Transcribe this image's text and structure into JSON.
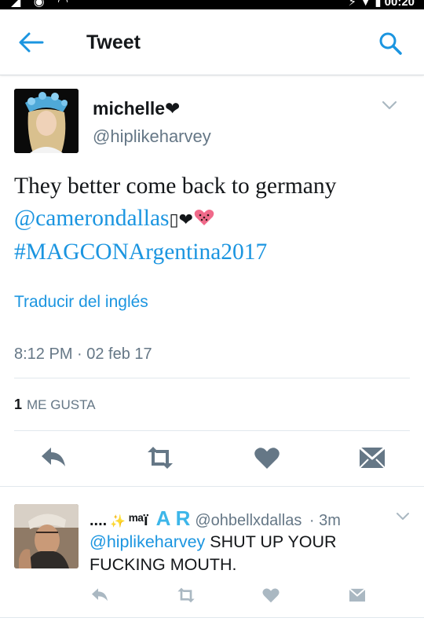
{
  "status_bar": {
    "left_icons": [
      "signal-icon",
      "wifi-icon"
    ],
    "right_text": "⚡ ▼ ▮ 00:20"
  },
  "app_bar": {
    "title": "Tweet",
    "back_icon": "back-arrow-icon",
    "search_icon": "search-icon"
  },
  "tweet": {
    "display_name": "michelle❤",
    "handle": "@hiplikeharvey",
    "text_plain": "They better come back to germany",
    "mention": "@camerondallas",
    "emoji_tail": "▯❤",
    "hashtag": "#MAGCONArgentina2017",
    "translate_label": "Traducir del inglés",
    "timestamp": "8:12 PM · 02 feb 17",
    "likes_count": "1",
    "likes_label": "ME GUSTA",
    "actions": [
      "reply-icon",
      "retweet-icon",
      "like-icon",
      "direct-message-icon"
    ]
  },
  "reply": {
    "name_prefix": "....",
    "name_mid": "ᵐᵃï",
    "name_blue": "A R",
    "handle": "@ohbellxdallas",
    "time": "· 3m",
    "mention": "@hiplikeharvey",
    "text": "SHUT UP YOUR FUCKING MOUTH.",
    "actions": [
      "reply-icon",
      "retweet-icon",
      "like-icon",
      "direct-message-icon"
    ]
  },
  "colors": {
    "accent": "#1b95e0",
    "secondary_text": "#657786",
    "icon_gray": "#657786",
    "divider": "#e1e8ed"
  }
}
